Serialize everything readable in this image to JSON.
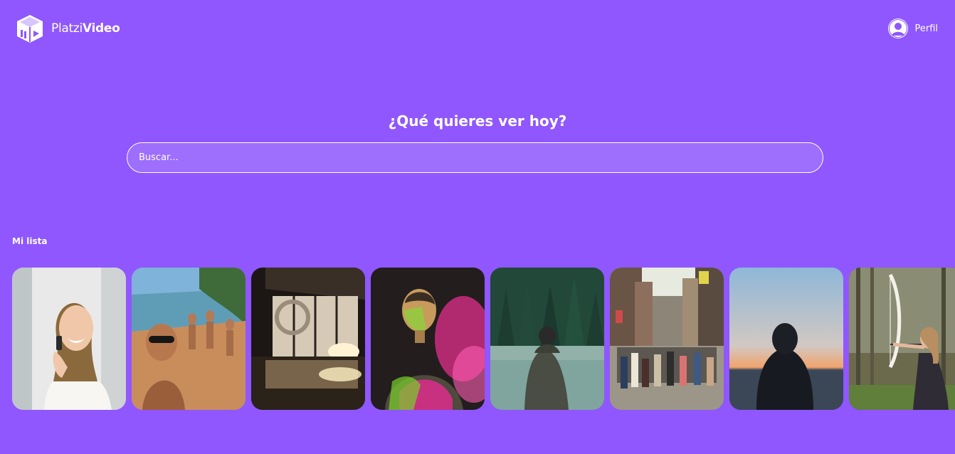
{
  "header": {
    "logo": {
      "text_light": "Platzi",
      "text_bold": "Video",
      "icon": "platzi-video-cube-icon"
    },
    "profile": {
      "label": "Perfil",
      "icon": "user-avatar-icon"
    }
  },
  "hero": {
    "title": "¿Qué quieres ver hoy?",
    "search_placeholder": "Buscar..."
  },
  "section": {
    "title": "Mi lista"
  },
  "cards": [
    {
      "id": "woman-phone"
    },
    {
      "id": "beach-friends"
    },
    {
      "id": "modern-hall"
    },
    {
      "id": "man-color-powder"
    },
    {
      "id": "lake-forest"
    },
    {
      "id": "city-street"
    },
    {
      "id": "hooded-sunset"
    },
    {
      "id": "girl-archery"
    }
  ],
  "colors": {
    "background": "#8f57fd",
    "text": "#ffffff"
  }
}
